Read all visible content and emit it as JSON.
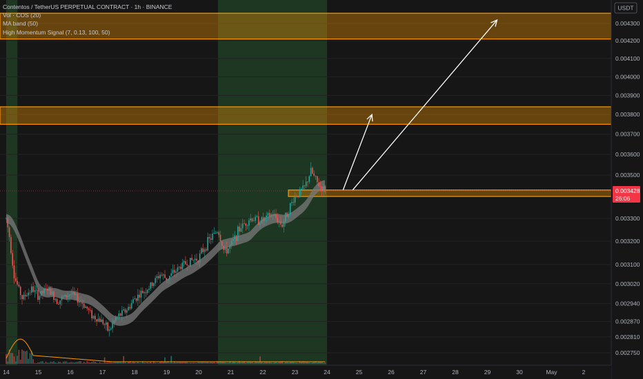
{
  "legend": {
    "symbol": "Contentos / TetherUS PERPETUAL CONTRACT · 1h · BINANCE",
    "vol": "Vol · COS (20)",
    "ma": "MA band (50)",
    "hms": "High Momentum Signal (7, 0.13, 100, 50)"
  },
  "currency": "USDT",
  "colors": {
    "up": "#26a69a",
    "down": "#ef5350",
    "zone": "#ff9800",
    "last_price_bg": "#f23645",
    "band": "#7a7a7a",
    "vol_ma": "#ff9800",
    "green_session": "#1e3d24"
  },
  "chart_data": {
    "type": "candlestick",
    "price_axis": {
      "ticks": [
        "0.004300",
        "0.004200",
        "0.004100",
        "0.004000",
        "0.003900",
        "0.003800",
        "0.003700",
        "0.003600",
        "0.003500",
        "0.003300",
        "0.003200",
        "0.003100",
        "0.003020",
        "0.002940",
        "0.002870",
        "0.002810",
        "0.002750"
      ],
      "scale": "log"
    },
    "date_axis": {
      "ticks": [
        "14",
        "15",
        "16",
        "17",
        "18",
        "19",
        "20",
        "21",
        "22",
        "23",
        "24",
        "25",
        "26",
        "27",
        "28",
        "29",
        "30",
        "May",
        "2"
      ]
    },
    "last_price": {
      "value": "0.003428",
      "countdown": "26:06"
    },
    "zones": [
      {
        "from": 0.00421,
        "to": 0.00436
      },
      {
        "from": 0.00375,
        "to": 0.00384
      },
      {
        "from": 0.0034,
        "to": 0.00343
      }
    ],
    "green_sessions": [
      {
        "from": "14",
        "to": "14.35"
      },
      {
        "from": "20.6",
        "to": "24"
      }
    ],
    "price_path": [
      [
        "14.0",
        0.0033
      ],
      [
        "14.1",
        0.00322
      ],
      [
        "14.25",
        0.00305
      ],
      [
        "14.5",
        0.00296
      ],
      [
        "14.8",
        0.003
      ],
      [
        "15.0",
        0.00297
      ],
      [
        "15.3",
        0.003
      ],
      [
        "15.6",
        0.00295
      ],
      [
        "16.0",
        0.00298
      ],
      [
        "16.4",
        0.00294
      ],
      [
        "16.7",
        0.00289
      ],
      [
        "17.0",
        0.00287
      ],
      [
        "17.2",
        0.00283
      ],
      [
        "17.4",
        0.00288
      ],
      [
        "17.8",
        0.00292
      ],
      [
        "18.0",
        0.00296
      ],
      [
        "18.5",
        0.00301
      ],
      [
        "18.8",
        0.00306
      ],
      [
        "19.0",
        0.00304
      ],
      [
        "19.5",
        0.0031
      ],
      [
        "20.0",
        0.00313
      ],
      [
        "20.3",
        0.0032
      ],
      [
        "20.6",
        0.00325
      ],
      [
        "20.8",
        0.00315
      ],
      [
        "21.0",
        0.00318
      ],
      [
        "21.3",
        0.00326
      ],
      [
        "21.6",
        0.0033
      ],
      [
        "22.0",
        0.00329
      ],
      [
        "22.3",
        0.00332
      ],
      [
        "22.6",
        0.00327
      ],
      [
        "22.8",
        0.00334
      ],
      [
        "23.0",
        0.0034
      ],
      [
        "23.3",
        0.00344
      ],
      [
        "23.5",
        0.00352
      ],
      [
        "23.7",
        0.00346
      ],
      [
        "23.9",
        0.00343
      ]
    ],
    "arrows": [
      {
        "from": [
          "24.5",
          0.00343
        ],
        "to": [
          "25.4",
          0.0038
        ]
      },
      {
        "from": [
          "24.8",
          0.00343
        ],
        "to": [
          "29.3",
          0.00432
        ]
      }
    ]
  }
}
